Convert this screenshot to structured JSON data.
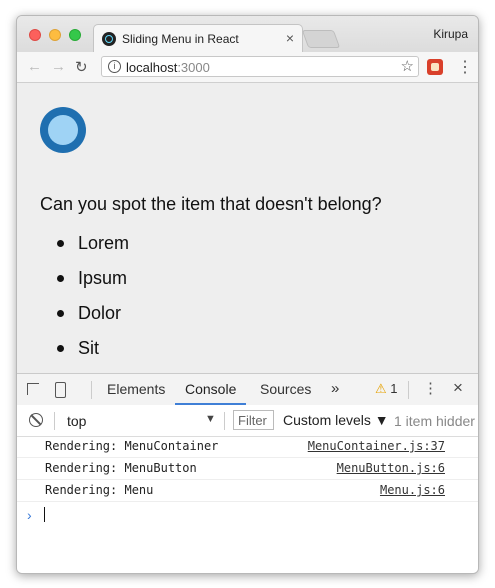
{
  "browser": {
    "tab_title": "Sliding Menu in React",
    "tab_close": "×",
    "profile_name": "Kirupa",
    "url_host": "localhost",
    "url_port": ":3000",
    "icons": [
      "back-arrow-icon",
      "forward-arrow-icon",
      "reload-icon",
      "info-icon",
      "star-icon",
      "extension-icon",
      "menu-dots-icon"
    ]
  },
  "page": {
    "question": "Can you spot the item that doesn't belong?",
    "items": [
      "Lorem",
      "Ipsum",
      "Dolor",
      "Sit"
    ],
    "circle_colors": {
      "outer": "#1f6fb0",
      "inner": "#9fd3f5"
    }
  },
  "devtools": {
    "tabs": [
      "Elements",
      "Console",
      "Sources"
    ],
    "active_tab": "Console",
    "more_label": "»",
    "warning_count": "1",
    "close": "×",
    "context": "top",
    "filter_placeholder": "Filter",
    "levels": "Custom levels ▼",
    "hidden_info": "1 item hidder",
    "logs": [
      {
        "message": "Rendering: MenuContainer",
        "source": "MenuContainer.js:37"
      },
      {
        "message": "Rendering: MenuButton",
        "source": "MenuButton.js:6"
      },
      {
        "message": "Rendering: Menu",
        "source": "Menu.js:6"
      }
    ],
    "prompt": "›"
  }
}
